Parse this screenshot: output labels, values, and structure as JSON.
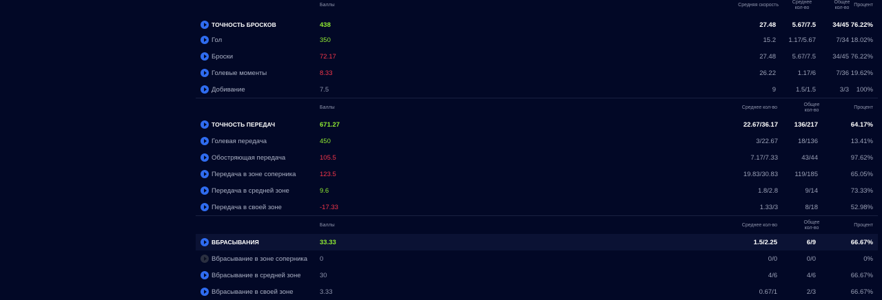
{
  "sections": [
    {
      "header": {
        "points": "Баллы",
        "speed": "Средняя скорость",
        "avg_l1": "Среднее",
        "avg_l2": "кол-во",
        "tot_l1": "Общее",
        "tot_l2": "кол-во",
        "pct": "Процент"
      },
      "total": {
        "label": "ТОЧНОСТЬ БРОСКОВ",
        "points": "438",
        "speed": "27.48",
        "avg": "5.67/7.5",
        "tot": "34/45",
        "pct": "76.22%"
      },
      "rows": [
        {
          "label": "Гол",
          "points": "350",
          "speed": "15.2",
          "avg": "1.17/5.67",
          "tot": "7/34",
          "pct": "18.02%"
        },
        {
          "label": "Броски",
          "points": "72.17",
          "speed": "27.48",
          "avg": "5.67/7.5",
          "tot": "34/45",
          "pct": "76.22%"
        },
        {
          "label": "Голевые моменты",
          "points": "8.33",
          "speed": "26.22",
          "avg": "1.17/6",
          "tot": "7/36",
          "pct": "19.62%"
        },
        {
          "label": "Добивание",
          "points": "7.5",
          "speed": "9",
          "avg": "1.5/1.5",
          "tot": "3/3",
          "pct": "100%"
        }
      ]
    },
    {
      "header": {
        "points": "Баллы",
        "avg": "Среднее кол-во",
        "tot_l1": "Общее",
        "tot_l2": "кол-во",
        "pct": "Процент"
      },
      "total": {
        "label": "ТОЧНОСТЬ ПЕРЕДАЧ",
        "points": "671.27",
        "avg": "22.67/36.17",
        "tot": "136/217",
        "pct": "64.17%"
      },
      "rows": [
        {
          "label": "Голевая передача",
          "points": "450",
          "avg": "3/22.67",
          "tot": "18/136",
          "pct": "13.41%"
        },
        {
          "label": "Обостряющая передача",
          "points": "105.5",
          "avg": "7.17/7.33",
          "tot": "43/44",
          "pct": "97.62%"
        },
        {
          "label": "Передача в зоне соперника",
          "points": "123.5",
          "avg": "19.83/30.83",
          "tot": "119/185",
          "pct": "65.05%"
        },
        {
          "label": "Передача в средней зоне",
          "points": "9.6",
          "avg": "1.8/2.8",
          "tot": "9/14",
          "pct": "73.33%"
        },
        {
          "label": "Передача в своей зоне",
          "points": "-17.33",
          "avg": "1.33/3",
          "tot": "8/18",
          "pct": "52.98%"
        }
      ]
    },
    {
      "header": {
        "points": "Баллы",
        "avg": "Среднее кол-во",
        "tot_l1": "Общее",
        "tot_l2": "кол-во",
        "pct": "Процент"
      },
      "total": {
        "label": "ВБРАСЫВАНИЯ",
        "points": "33.33",
        "avg": "1.5/2.25",
        "tot": "6/9",
        "pct": "66.67%"
      },
      "rows": [
        {
          "label": "Вбрасывание в зоне соперника",
          "points": "0",
          "avg": "0/0",
          "tot": "0/0",
          "pct": "0%"
        },
        {
          "label": "Вбрасывание в средней зоне",
          "points": "30",
          "avg": "4/6",
          "tot": "4/6",
          "pct": "66.67%"
        },
        {
          "label": "Вбрасывание в своей зоне",
          "points": "3.33",
          "avg": "0.67/1",
          "tot": "2/3",
          "pct": "66.67%"
        }
      ]
    }
  ],
  "colors": {
    "positive": "#8fe832",
    "negative": "#f5364a",
    "neutral": "#8d93ab",
    "icon": "#2f6cf0",
    "background": "#020826"
  },
  "icons": {
    "row": "play-circle-icon"
  }
}
